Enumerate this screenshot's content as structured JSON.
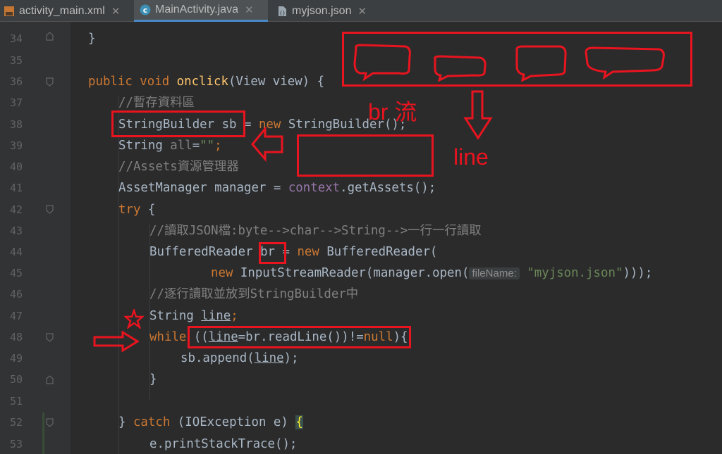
{
  "tabs": [
    {
      "label": "activity_main.xml",
      "icon": "xml-file-icon",
      "active": false
    },
    {
      "label": "MainActivity.java",
      "icon": "java-class-icon",
      "active": true
    },
    {
      "label": "myjson.json",
      "icon": "json-file-icon",
      "active": false
    }
  ],
  "lines": {
    "34": "34",
    "35": "35",
    "36": "36",
    "37": "37",
    "38": "38",
    "39": "39",
    "40": "40",
    "41": "41",
    "42": "42",
    "43": "43",
    "44": "44",
    "45": "45",
    "46": "46",
    "47": "47",
    "48": "48",
    "49": "49",
    "50": "50",
    "51": "51",
    "52": "52",
    "53": "53"
  },
  "code": {
    "l34": "}",
    "l36_kw": "public void ",
    "l36_fn": "onclick",
    "l36_rest": "(View view) {",
    "l37": "//暫存資料區",
    "l38_a": "StringBuilder sb",
    "l38_b": " = ",
    "l38_kw": "new",
    "l38_c": " StringBuilder();",
    "l39_a": "String ",
    "l39_b": "all",
    "l39_c": "=",
    "l39_str": "\"\"",
    "l39_d": ";",
    "l40": "//Assets資源管理器",
    "l41_a": "AssetManager manager = ",
    "l41_fld": "context",
    "l41_b": ".getAssets();",
    "l42_kw": "try",
    "l42_b": " {",
    "l43": "//讀取JSON檔:byte-->char-->String-->一行一行讀取",
    "l44_a": "BufferedReader ",
    "l44_br": "br",
    "l44_b": " = ",
    "l44_kw": "new",
    "l44_c": " BufferedReader(",
    "l45_kw": "new",
    "l45_a": " InputStreamReader(manager.open(",
    "l45_hint": "fileName:",
    "l45_str": "\"myjson.json\"",
    "l45_b": ")));",
    "l46": "//逐行讀取並放到StringBuilder中",
    "l47_a": "String ",
    "l47_var": "line",
    "l47_b": ";",
    "l48_kw": "while",
    "l48_a": " ((",
    "l48_var": "line",
    "l48_b": "=br.readLine())!=",
    "l48_null": "null",
    "l48_c": "){",
    "l49_a": "sb.append(",
    "l49_var": "line",
    "l49_b": ");",
    "l50": "}",
    "l52_a": "} ",
    "l52_kw": "catch",
    "l52_b": " (IOException e) ",
    "l52_brace": "{",
    "l53": "e.printStackTrace();"
  },
  "annotations": {
    "br_stream_label": "br 流",
    "line_label": "line",
    "color": "#e8141f"
  },
  "colors": {
    "background": "#2b2b2b",
    "keyword": "#cc7832",
    "method": "#ffc66d",
    "string": "#6a8759",
    "comment": "#808080",
    "field": "#9876aa",
    "text": "#a9b7c6",
    "active_tab_underline": "#4a88c7"
  }
}
